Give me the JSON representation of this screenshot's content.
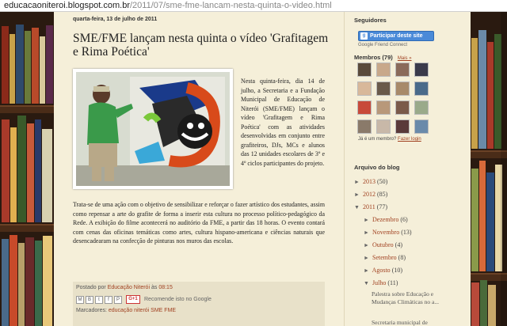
{
  "browser": {
    "url_host": "educacaoniteroi.blogspot.com.br",
    "url_path": "/2011/07/sme-fme-lancam-nesta-quinta-o-video.html"
  },
  "post": {
    "date": "quarta-feira, 13 de julho de 2011",
    "title": "SME/FME lançam nesta quinta o vídeo 'Grafitagem e Rima Poética'",
    "intro": "Nesta quinta-feira, dia 14 de julho, a Secretaria e a Fundação Municipal de Educação de Niterói (SME/FME) lançam o vídeo 'Grafitagem e Rima Poética' com as atividades desenvolvidas em conjunto entre grafiteiros, DJs, MCs e alunos das 12 unidades escolares de 3º e 4º ciclos participantes do projeto.",
    "body": "Trata-se de uma ação com o objetivo de sensibilizar e reforçar o fazer artístico dos estudantes, assim como repensar a arte do grafite de forma a inserir esta cultura no processo político-pedagógico da Rede. A exibição do filme acontecerá no auditório da FME, a partir das 18 horas. O evento contará com cenas das oficinas temáticas como artes, cultura hispano-americana e ciências naturais que desencadearam na confecção de pinturas nos muros das escolas.",
    "posted_by_prefix": "Postado por",
    "author": "Educação Niterói",
    "time_prefix": "às",
    "time": "08:15",
    "share_icons": [
      "M",
      "B",
      "t",
      "f",
      "P"
    ],
    "gplus_label": "G+1",
    "recommend": "Recomende isto no Google",
    "labels_prefix": "Marcadores:",
    "labels": "educação niterói SME FME"
  },
  "sidebar": {
    "followers_title": "Seguidores",
    "gfc_button": "Participar deste site",
    "gfc_sub": "Google Friend Connect",
    "members_title": "Membros (79)",
    "more_link": "Mais »",
    "already_member": "Já é um membro?",
    "login_link": "Fazer login",
    "archive_title": "Arquivo do blog",
    "archive": [
      {
        "arrow": "►",
        "label": "2013",
        "count": "(50)"
      },
      {
        "arrow": "►",
        "label": "2012",
        "count": "(85)"
      },
      {
        "arrow": "▼",
        "label": "2011",
        "count": "(77)"
      },
      {
        "arrow": "►",
        "label": "Dezembro",
        "count": "(6)"
      },
      {
        "arrow": "►",
        "label": "Novembro",
        "count": "(13)"
      },
      {
        "arrow": "►",
        "label": "Outubro",
        "count": "(4)"
      },
      {
        "arrow": "►",
        "label": "Setembro",
        "count": "(8)"
      },
      {
        "arrow": "►",
        "label": "Agosto",
        "count": "(10)"
      },
      {
        "arrow": "▼",
        "label": "Julho",
        "count": "(11)"
      }
    ],
    "july_posts": [
      "Palestra sobre Educação e Mudanças Climáticas no a...",
      "Secretaria municipal de"
    ]
  },
  "colors": {
    "link": "#a04020",
    "page_bg": "#f5efd9",
    "gfc_blue": "#4a8ad8"
  }
}
